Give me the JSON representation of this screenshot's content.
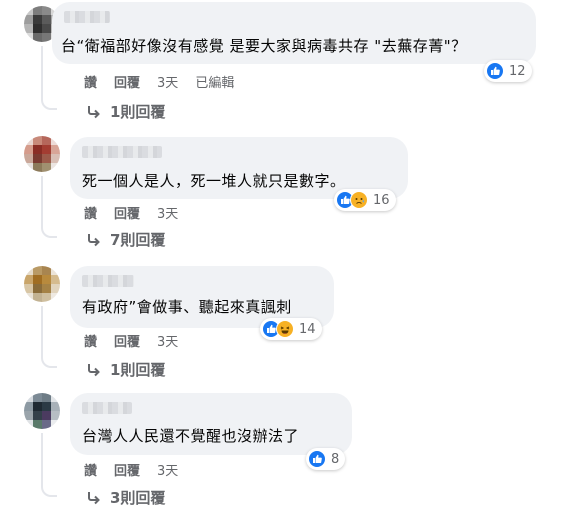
{
  "comments": [
    {
      "text": "台“衛福部好像沒有感覺 是要大家與病毒共存 \"去蕪存菁\"？",
      "reaction_count": "12",
      "reactions": [
        "like-icon"
      ],
      "like_label": "讚",
      "reply_label": "回覆",
      "time": "3天",
      "edited": "已編輯",
      "replies": "1則回覆"
    },
    {
      "text": "死一個人是人，死一堆人就只是數字。",
      "reaction_count": "16",
      "reactions": [
        "like-icon",
        "sad-icon"
      ],
      "like_label": "讚",
      "reply_label": "回覆",
      "time": "3天",
      "replies": "7則回覆"
    },
    {
      "text": "有政府”會做事、聽起來真諷刺",
      "reaction_count": "14",
      "reactions": [
        "like-icon",
        "haha-icon"
      ],
      "like_label": "讚",
      "reply_label": "回覆",
      "time": "3天",
      "replies": "1則回覆"
    },
    {
      "text": "台灣人人民還不覺醒也沒辦法了",
      "reaction_count": "8",
      "reactions": [
        "like-icon"
      ],
      "like_label": "讚",
      "reply_label": "回覆",
      "time": "3天",
      "replies": "3則回覆"
    }
  ],
  "colors": {
    "bubble": "#f0f2f5",
    "meta": "#65676b",
    "like": "#1877f2",
    "emoji": "#f7b125"
  }
}
